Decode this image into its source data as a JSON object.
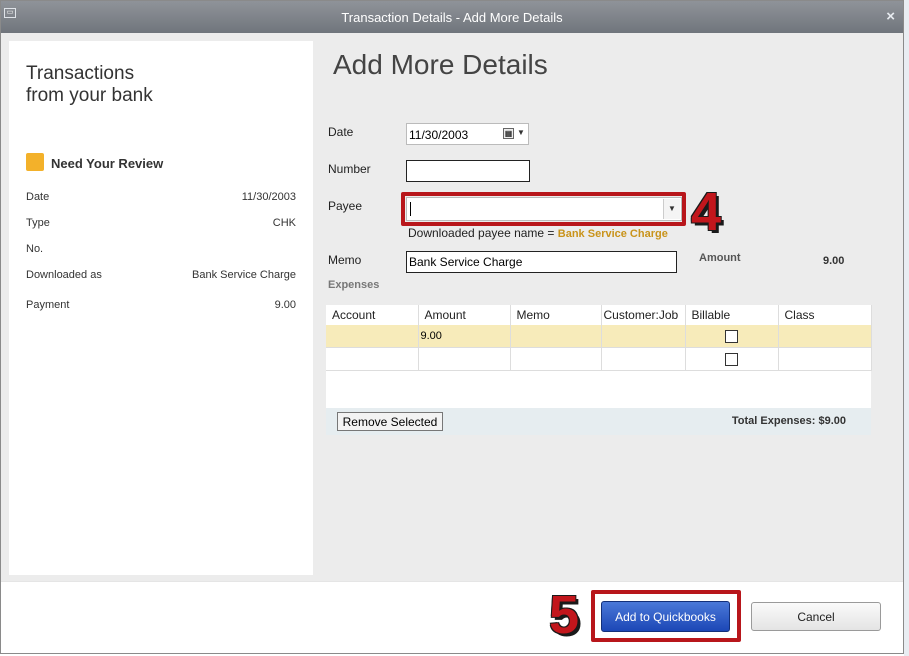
{
  "window": {
    "title": "Transaction Details - Add More Details",
    "close_glyph": "×"
  },
  "left_panel": {
    "title": "Transactions\nfrom your bank",
    "status": "Need Your Review",
    "status_color": "#f3b12a",
    "fields": [
      {
        "label": "Date",
        "value": "11/30/2003"
      },
      {
        "label": "Type",
        "value": "CHK"
      },
      {
        "label": "No.",
        "value": ""
      },
      {
        "label": "Downloaded as",
        "value": "Bank Service Charge"
      },
      {
        "label": "Payment",
        "value": "9.00"
      }
    ]
  },
  "form": {
    "heading": "Add More Details",
    "date_label": "Date",
    "date_value": "11/30/2003",
    "number_label": "Number",
    "number_value": "",
    "payee_label": "Payee",
    "payee_value": "",
    "downloaded_payee_prefix": "Downloaded payee name =",
    "downloaded_payee_value": "Bank Service Charge",
    "memo_label": "Memo",
    "memo_value": "Bank Service Charge",
    "amount_label": "Amount",
    "amount_value": "9.00",
    "expenses_label": "Expenses"
  },
  "expenses_table": {
    "columns": [
      "Account",
      "Amount",
      "Memo",
      "Customer:Job",
      "Billable",
      "Class"
    ],
    "rows": [
      {
        "account": "",
        "amount": "9.00",
        "memo": "",
        "customer_job": "",
        "billable": false,
        "class": ""
      },
      {
        "account": "",
        "amount": "",
        "memo": "",
        "customer_job": "",
        "billable": false,
        "class": ""
      }
    ],
    "remove_button": "Remove Selected",
    "total": "Total Expenses: $9.00"
  },
  "annotations": {
    "step4": "4",
    "step5": "5",
    "highlight_color": "#b8161b"
  },
  "buttons": {
    "add": "Add to Quickbooks",
    "cancel": "Cancel"
  }
}
